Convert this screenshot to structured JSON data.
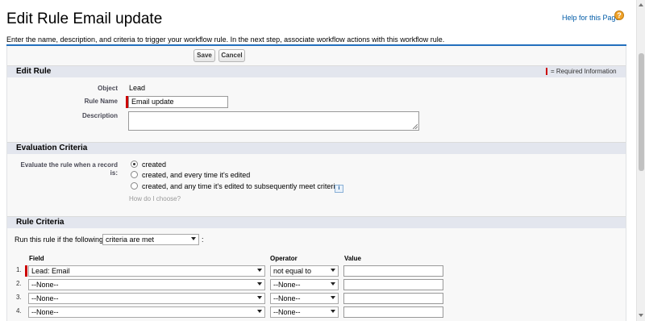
{
  "page": {
    "title": "Edit Rule Email update",
    "help_link": "Help for this Page",
    "intro": "Enter the name, description, and criteria to trigger your workflow rule. In the next step, associate workflow actions with this workflow rule."
  },
  "buttons": {
    "save": "Save",
    "cancel": "Cancel"
  },
  "edit_rule": {
    "title": "Edit Rule",
    "required_info": "= Required Information",
    "object_label": "Object",
    "object_value": "Lead",
    "rule_name_label": "Rule Name",
    "rule_name_value": "Email update",
    "description_label": "Description",
    "description_value": ""
  },
  "evaluation": {
    "title": "Evaluation Criteria",
    "label": "Evaluate the rule when a record is:",
    "options": [
      {
        "label": "created",
        "checked": true
      },
      {
        "label": "created, and every time it's edited",
        "checked": false
      },
      {
        "label": "created, and any time it's edited to subsequently meet criteria",
        "checked": false
      }
    ],
    "info_icon": "info-icon",
    "how_link": "How do I choose?"
  },
  "rule_criteria": {
    "title": "Rule Criteria",
    "run_prefix": "Run this rule if the following",
    "run_select": "criteria are met",
    "run_suffix": ":",
    "columns": {
      "field": "Field",
      "operator": "Operator",
      "value": "Value"
    },
    "rows": [
      {
        "num": "1.",
        "field": "Lead: Email",
        "operator": "not equal to",
        "value": ""
      },
      {
        "num": "2.",
        "field": "--None--",
        "operator": "--None--",
        "value": ""
      },
      {
        "num": "3.",
        "field": "--None--",
        "operator": "--None--",
        "value": ""
      },
      {
        "num": "4.",
        "field": "--None--",
        "operator": "--None--",
        "value": ""
      }
    ]
  },
  "colors": {
    "accent": "#236fbd",
    "section_bg": "#e3e6ee",
    "required": "#cc0000",
    "link": "#015ba7"
  }
}
